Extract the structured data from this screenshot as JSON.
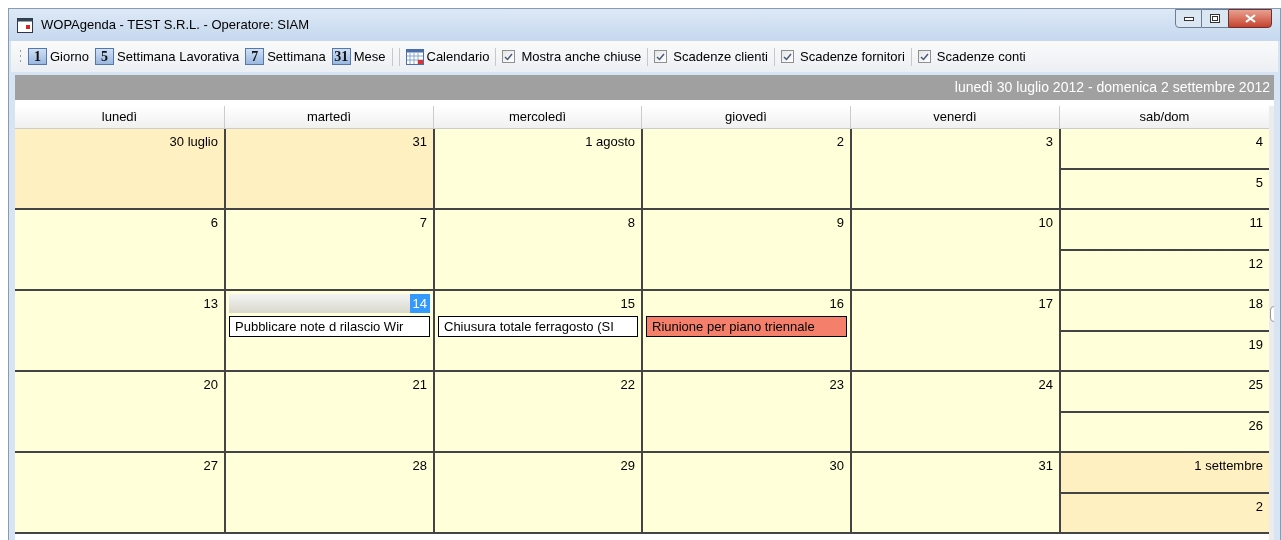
{
  "window": {
    "title": "WOPAgenda - TEST S.R.L. - Operatore: SIAM"
  },
  "toolbar": {
    "views": [
      {
        "kind": "day",
        "icon_text": "1",
        "label": "Giorno"
      },
      {
        "kind": "day",
        "icon_text": "5",
        "label": "Settimana Lavorativa"
      },
      {
        "kind": "day",
        "icon_text": "7",
        "label": "Settimana"
      },
      {
        "kind": "day",
        "icon_text": "31",
        "label": "Mese"
      },
      {
        "kind": "calendar",
        "label": "Calendario"
      }
    ],
    "checks": [
      {
        "label": "Mostra anche chiuse",
        "checked": true
      },
      {
        "label": "Scadenze clienti",
        "checked": true
      },
      {
        "label": "Scadenze fornitori",
        "checked": true
      },
      {
        "label": "Scadenze conti",
        "checked": true
      }
    ]
  },
  "range": "lunedì 30 luglio 2012 - domenica 2 settembre 2012",
  "columns": [
    "lunedì",
    "martedì",
    "mercoledì",
    "giovedì",
    "venerdì",
    "sab/dom"
  ],
  "weeks": [
    {
      "days": [
        {
          "label": "30 luglio",
          "in_month": false,
          "selected": false
        },
        {
          "label": "31",
          "in_month": false,
          "selected": false
        },
        {
          "label": "1 agosto",
          "in_month": true,
          "selected": false
        },
        {
          "label": "2",
          "in_month": true,
          "selected": false
        },
        {
          "label": "3",
          "in_month": true,
          "selected": false
        }
      ],
      "weekend": [
        {
          "label": "4",
          "in_month": true
        },
        {
          "label": "5",
          "in_month": true
        }
      ]
    },
    {
      "days": [
        {
          "label": "6",
          "in_month": true,
          "selected": false
        },
        {
          "label": "7",
          "in_month": true,
          "selected": false
        },
        {
          "label": "8",
          "in_month": true,
          "selected": false
        },
        {
          "label": "9",
          "in_month": true,
          "selected": false
        },
        {
          "label": "10",
          "in_month": true,
          "selected": false
        }
      ],
      "weekend": [
        {
          "label": "11",
          "in_month": true
        },
        {
          "label": "12",
          "in_month": true
        }
      ]
    },
    {
      "days": [
        {
          "label": "13",
          "in_month": true,
          "selected": false
        },
        {
          "label": "14",
          "in_month": true,
          "selected": true,
          "events": [
            {
              "text": "Pubblicare note d rilascio Wir",
              "color": "#ffffff"
            }
          ]
        },
        {
          "label": "15",
          "in_month": true,
          "selected": false,
          "events": [
            {
              "text": "Chiusura totale ferragosto (SI",
              "color": "#ffffff"
            }
          ]
        },
        {
          "label": "16",
          "in_month": true,
          "selected": false,
          "events": [
            {
              "text": "Riunione per piano triennale",
              "color": "#f4806c"
            }
          ]
        },
        {
          "label": "17",
          "in_month": true,
          "selected": false
        }
      ],
      "weekend": [
        {
          "label": "18",
          "in_month": true
        },
        {
          "label": "19",
          "in_month": true
        }
      ]
    },
    {
      "days": [
        {
          "label": "20",
          "in_month": true,
          "selected": false
        },
        {
          "label": "21",
          "in_month": true,
          "selected": false
        },
        {
          "label": "22",
          "in_month": true,
          "selected": false
        },
        {
          "label": "23",
          "in_month": true,
          "selected": false
        },
        {
          "label": "24",
          "in_month": true,
          "selected": false
        }
      ],
      "weekend": [
        {
          "label": "25",
          "in_month": true
        },
        {
          "label": "26",
          "in_month": true
        }
      ]
    },
    {
      "days": [
        {
          "label": "27",
          "in_month": true,
          "selected": false
        },
        {
          "label": "28",
          "in_month": true,
          "selected": false
        },
        {
          "label": "29",
          "in_month": true,
          "selected": false
        },
        {
          "label": "30",
          "in_month": true,
          "selected": false
        },
        {
          "label": "31",
          "in_month": true,
          "selected": false
        }
      ],
      "weekend": [
        {
          "label": "1 settembre",
          "in_month": false
        },
        {
          "label": "2",
          "in_month": false
        }
      ]
    }
  ]
}
